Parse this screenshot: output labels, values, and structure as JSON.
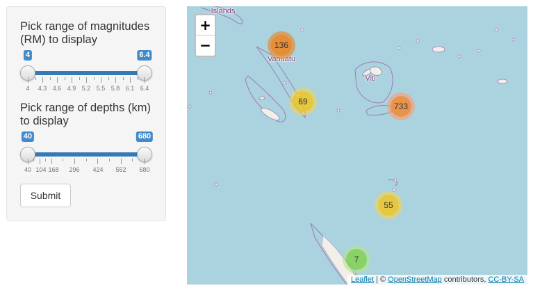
{
  "sidebar": {
    "magnitude": {
      "label": "Pick range of magnitudes (RM) to display",
      "min_value": "4",
      "max_value": "6.4",
      "ticks": [
        "4",
        "4.3",
        "4.6",
        "4.9",
        "5.2",
        "5.5",
        "5.8",
        "6.1",
        "6.4"
      ]
    },
    "depth": {
      "label": "Pick range of depths (km) to display",
      "min_value": "40",
      "max_value": "680",
      "ticks": [
        "40",
        "104",
        "168",
        "296",
        "424",
        "552",
        "680"
      ]
    },
    "submit_label": "Submit",
    "slider_color": "#337ab7"
  },
  "map": {
    "zoom_in": "+",
    "zoom_out": "−",
    "labels": {
      "islands": "Islands",
      "vanuatu": "Vanuatu",
      "viti": "Viti"
    },
    "clusters": [
      {
        "name": "cluster-136",
        "count": "136",
        "color": "orange"
      },
      {
        "name": "cluster-69",
        "count": "69",
        "color": "yellow"
      },
      {
        "name": "cluster-733",
        "count": "733",
        "color": "orange"
      },
      {
        "name": "cluster-55",
        "count": "55",
        "color": "yellow"
      },
      {
        "name": "cluster-7",
        "count": "7",
        "color": "green"
      }
    ],
    "attribution": {
      "leaflet": "Leaflet",
      "sep": " | © ",
      "osm": "OpenStreetMap",
      "contributors": " contributors, ",
      "license": "CC-BY-SA"
    },
    "colors": {
      "water": "#aad3df",
      "land": "#f2efe9",
      "border": "#9e7bb0"
    }
  }
}
